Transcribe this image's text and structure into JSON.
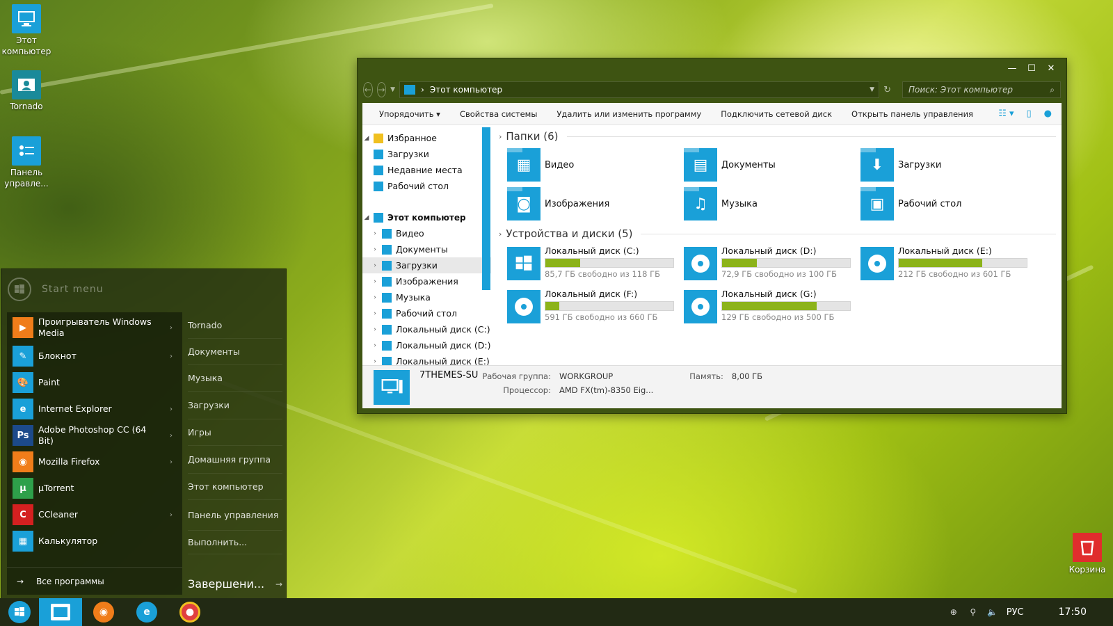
{
  "desktop": {
    "icons": [
      {
        "label": "Этот компьютер"
      },
      {
        "label": "Tornado"
      },
      {
        "label": "Панель управле..."
      }
    ],
    "recycle_bin": "Корзина"
  },
  "explorer": {
    "address": "Этот компьютер",
    "search_placeholder": "Поиск: Этот компьютер",
    "commands": [
      "Упорядочить",
      "Свойства системы",
      "Удалить или изменить программу",
      "Подключить сетевой диск",
      "Открыть панель управления"
    ],
    "nav": {
      "favorites": "Избранное",
      "favorite_items": [
        "Загрузки",
        "Недавние места",
        "Рабочий стол"
      ],
      "computer": "Этот компьютер",
      "computer_items": [
        "Видео",
        "Документы",
        "Загрузки",
        "Изображения",
        "Музыка",
        "Рабочий стол",
        "Локальный диск (C:)",
        "Локальный диск (D:)",
        "Локальный диск (E:)"
      ]
    },
    "folders_header": "Папки (6)",
    "folders": [
      "Видео",
      "Документы",
      "Загрузки",
      "Изображения",
      "Музыка",
      "Рабочий стол"
    ],
    "drives_header": "Устройства и диски (5)",
    "drives": [
      {
        "name": "Локальный диск (C:)",
        "free": "85,7 ГБ свободно из 118 ГБ",
        "used_fraction": 0.27
      },
      {
        "name": "Локальный диск (D:)",
        "free": "72,9 ГБ свободно из 100 ГБ",
        "used_fraction": 0.27
      },
      {
        "name": "Локальный диск (E:)",
        "free": "212 ГБ свободно из 601 ГБ",
        "used_fraction": 0.65
      },
      {
        "name": "Локальный диск (F:)",
        "free": "591 ГБ свободно из 660 ГБ",
        "used_fraction": 0.11
      },
      {
        "name": "Локальный диск (G:)",
        "free": "129 ГБ свободно из 500 ГБ",
        "used_fraction": 0.74
      }
    ],
    "details": {
      "pc_name": "7THEMES-SU",
      "workgroup_label": "Рабочая группа:",
      "workgroup": "WORKGROUP",
      "memory_label": "Память:",
      "memory": "8,00 ГБ",
      "cpu_label": "Процессор:",
      "cpu": "AMD FX(tm)-8350 Eig..."
    }
  },
  "start_menu": {
    "search_hint": "Start menu",
    "programs": [
      {
        "label": "Проигрыватель Windows Media",
        "color": "#f07d1a",
        "glyph": "▶"
      },
      {
        "label": "Блокнот",
        "color": "#1aa0d8",
        "glyph": "✎"
      },
      {
        "label": "Paint",
        "color": "#1aa0d8",
        "glyph": "🎨"
      },
      {
        "label": "Internet Explorer",
        "color": "#1aa0d8",
        "glyph": "e"
      },
      {
        "label": "Adobe Photoshop CC (64 Bit)",
        "color": "#1c4a8a",
        "glyph": "Ps"
      },
      {
        "label": "Mozilla Firefox",
        "color": "#f07d1a",
        "glyph": "◉"
      },
      {
        "label": "µTorrent",
        "color": "#2ea04a",
        "glyph": "μ"
      },
      {
        "label": "CCleaner",
        "color": "#d42020",
        "glyph": "C"
      },
      {
        "label": "Калькулятор",
        "color": "#1aa0d8",
        "glyph": "▦"
      }
    ],
    "all_programs": "Все программы",
    "places": [
      "Tornado",
      "Документы",
      "Музыка",
      "Загрузки",
      "Игры",
      "Домашняя группа",
      "Этот компьютер",
      "Панель управления",
      "Выполнить..."
    ],
    "shutdown": "Завершени..."
  },
  "taskbar": {
    "language": "РУС",
    "time": "17:50"
  }
}
